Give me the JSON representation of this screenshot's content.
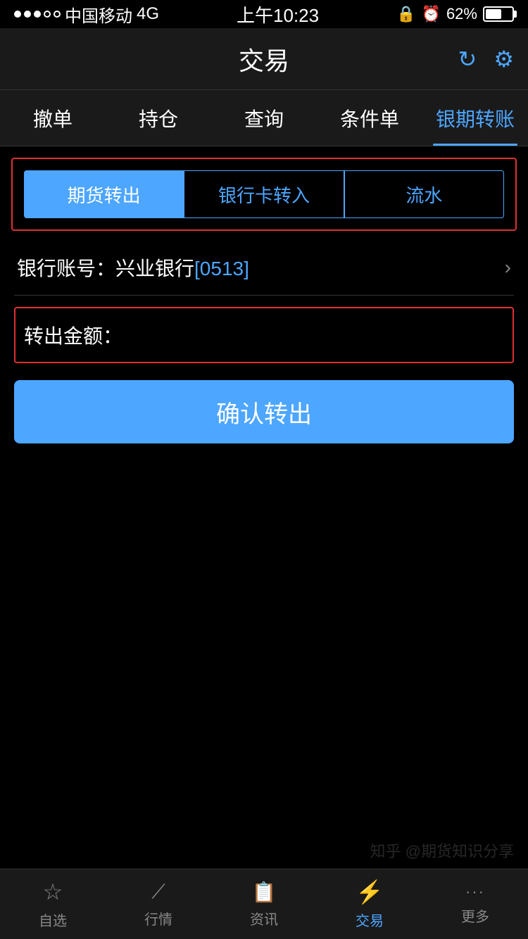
{
  "statusBar": {
    "carrier": "中国移动",
    "network": "4G",
    "time": "上午10:23",
    "battery": "62%"
  },
  "header": {
    "title": "交易",
    "refreshIcon": "↻",
    "settingsIcon": "⚙"
  },
  "navTabs": [
    {
      "label": "撤单",
      "active": false
    },
    {
      "label": "持仓",
      "active": false
    },
    {
      "label": "查询",
      "active": false
    },
    {
      "label": "条件单",
      "active": false
    },
    {
      "label": "银期转账",
      "active": true
    }
  ],
  "subTabs": [
    {
      "label": "期货转出",
      "active": true
    },
    {
      "label": "银行卡转入",
      "active": false
    },
    {
      "label": "流水",
      "active": false
    }
  ],
  "bankAccount": {
    "label": "银行账号：兴业银行",
    "highlight": "[0513]"
  },
  "amountField": {
    "label": "转出金额：",
    "placeholder": ""
  },
  "confirmButton": {
    "label": "确认转出"
  },
  "bottomNav": [
    {
      "label": "自选",
      "icon": "☆",
      "active": false
    },
    {
      "label": "行情",
      "icon": "📈",
      "active": false
    },
    {
      "label": "资讯",
      "icon": "📄",
      "active": false
    },
    {
      "label": "交易",
      "icon": "⚡",
      "active": true
    },
    {
      "label": "更多",
      "icon": "•••",
      "active": false
    }
  ],
  "watermark": "知乎 @期货知识分享"
}
